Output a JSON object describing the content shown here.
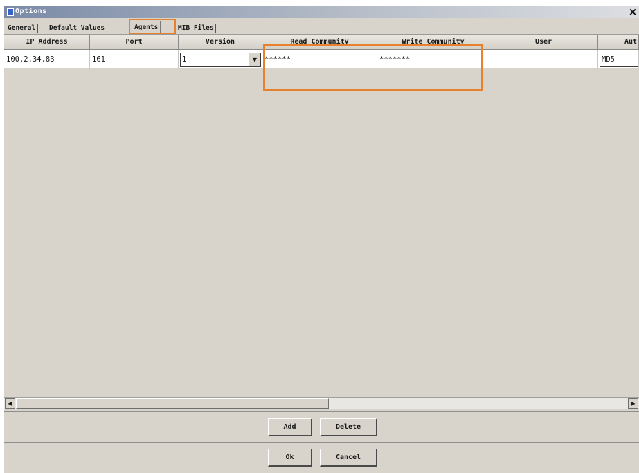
{
  "window": {
    "title": "Options",
    "close_glyph": "×"
  },
  "tabs": [
    {
      "label": "General",
      "active": false
    },
    {
      "label": "Default Values",
      "active": false
    },
    {
      "label": "Agents",
      "active": true
    },
    {
      "label": "MIB Files",
      "active": false
    }
  ],
  "table": {
    "columns": [
      "IP Address",
      "Port",
      "Version",
      "Read Community",
      "Write Community",
      "User",
      "Aut"
    ],
    "rows": [
      {
        "ip_address": "100.2.34.83",
        "port": "161",
        "version": "1",
        "read_community": "******",
        "write_community": "*******",
        "user": "",
        "auth": "MD5"
      }
    ]
  },
  "buttons": {
    "add": "Add",
    "delete": "Delete",
    "ok": "Ok",
    "cancel": "Cancel"
  },
  "icons": {
    "dropdown": "chevron-down-icon",
    "scroll_left": "scroll-left-icon",
    "scroll_right": "scroll-right-icon",
    "close": "close-icon"
  },
  "colors": {
    "highlight": "#e8812d",
    "face": "#d8d4cc"
  }
}
